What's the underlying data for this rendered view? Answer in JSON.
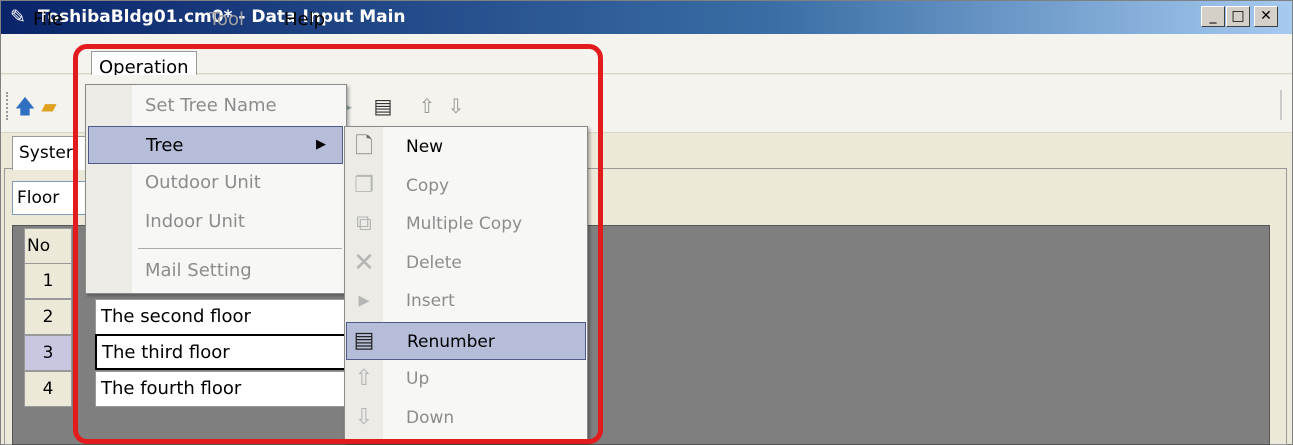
{
  "window": {
    "title": "ToshibaBldg01.cm0* - Data Input Main",
    "app_icon": "wrench-icon",
    "controls": {
      "minimize": "_",
      "maximize": "□",
      "close": "✕"
    }
  },
  "menubar": {
    "items": [
      "File",
      "Operation",
      "Tool",
      "Help"
    ]
  },
  "toolbar": {
    "icons": [
      "open-icon",
      "folder-icon",
      "insert-icon",
      "renumber-icon",
      "up-arrow-icon",
      "down-arrow-icon"
    ]
  },
  "tab": {
    "label": "Syster"
  },
  "floor_select": {
    "value": "Floor"
  },
  "grid": {
    "column_no": "No",
    "rows": [
      {
        "no": "1",
        "name": ""
      },
      {
        "no": "2",
        "name": "The second floor"
      },
      {
        "no": "3",
        "name": "The third floor"
      },
      {
        "no": "4",
        "name": "The fourth floor"
      }
    ]
  },
  "operation_menu": {
    "items": [
      {
        "label": "Set Tree Name",
        "enabled": false
      },
      {
        "label": "Tree",
        "enabled": true,
        "submenu": true,
        "highlighted": true
      },
      {
        "label": "Outdoor Unit",
        "enabled": false
      },
      {
        "label": "Indoor Unit",
        "enabled": false
      },
      {
        "label": "Mail Setting",
        "enabled": false
      }
    ]
  },
  "tree_submenu": {
    "items": [
      {
        "label": "New",
        "icon": "new-document-icon",
        "enabled": true
      },
      {
        "label": "Copy",
        "icon": "copy-icon",
        "enabled": false
      },
      {
        "label": "Multiple Copy",
        "icon": "multiple-copy-icon",
        "enabled": false
      },
      {
        "label": "Delete",
        "icon": "delete-icon",
        "enabled": false
      },
      {
        "label": "Insert",
        "icon": "insert-icon",
        "enabled": false
      },
      {
        "label": "Renumber",
        "icon": "renumber-icon",
        "enabled": true,
        "highlighted": true
      },
      {
        "label": "Up",
        "icon": "up-arrow-icon",
        "enabled": false
      },
      {
        "label": "Down",
        "icon": "down-arrow-icon",
        "enabled": false
      }
    ]
  },
  "colors": {
    "highlight_border": "#e21c1c",
    "menu_active": "#b6bdd8",
    "disabled_text": "#8c8c8c",
    "grid_background": "#7f7f7f"
  }
}
